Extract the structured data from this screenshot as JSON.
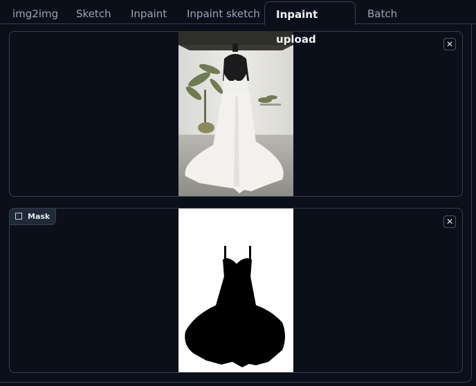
{
  "tabs": [
    {
      "label": "img2img",
      "active": false
    },
    {
      "label": "Sketch",
      "active": false
    },
    {
      "label": "Inpaint",
      "active": false
    },
    {
      "label": "Inpaint sketch",
      "active": false
    },
    {
      "label": "Inpaint upload",
      "active": true
    },
    {
      "label": "Batch",
      "active": false
    }
  ],
  "image_upload": {
    "image_description": "Photo of a white wedding gown with a long train on a black mannequin, with potted plants and white curtains in background",
    "clear_icon": "close-icon"
  },
  "mask_upload": {
    "label": "Mask",
    "label_icon": "image-icon",
    "image_description": "Black silhouette mask of a wedding gown on white background",
    "clear_icon": "close-icon"
  },
  "colors": {
    "background": "#0b0f19",
    "border": "#374151",
    "tab_text": "#9ca3af",
    "tab_active_text": "#f3f4f6"
  }
}
